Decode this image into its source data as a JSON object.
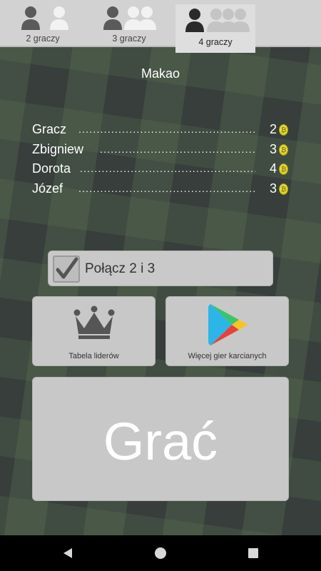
{
  "tabs": [
    {
      "label": "2 graczy",
      "players": 2,
      "selected": false
    },
    {
      "label": "3 graczy",
      "players": 3,
      "selected": false
    },
    {
      "label": "4 graczy",
      "players": 4,
      "selected": true
    }
  ],
  "title": "Makao",
  "scores": [
    {
      "name": "Gracz",
      "value": "2"
    },
    {
      "name": "Zbigniew",
      "value": "3"
    },
    {
      "name": "Dorota",
      "value": "4"
    },
    {
      "name": "Józef",
      "value": "3"
    }
  ],
  "option": {
    "label": "Połącz 2 i 3",
    "checked": true
  },
  "buttons": {
    "leaderboard": "Tabela liderów",
    "more_games": "Więcej gier karcianych",
    "play": "Grać"
  },
  "nav": {
    "back_icon": "back-triangle-icon",
    "home_icon": "home-circle-icon",
    "recents_icon": "recents-square-icon"
  },
  "colors": {
    "tab_bar": "#d2d2d2",
    "button_bg": "#c8c8c8",
    "coin": "#e8dc33",
    "background": "#3d4540"
  }
}
